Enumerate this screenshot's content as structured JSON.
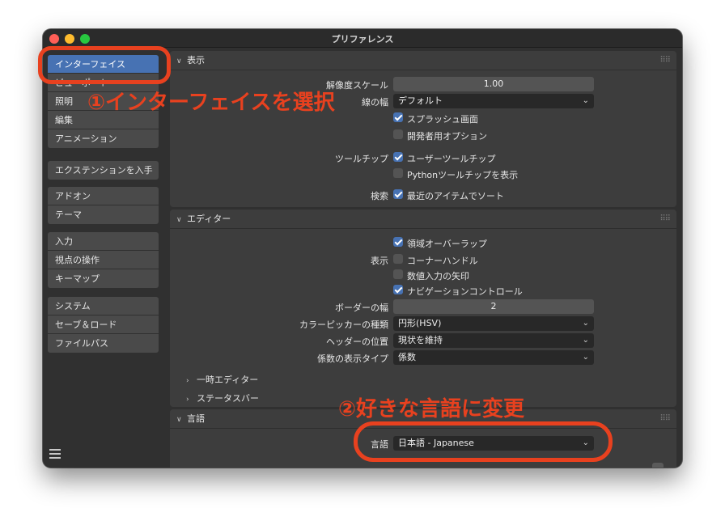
{
  "window": {
    "title": "プリファレンス"
  },
  "sidebar": {
    "groups": [
      [
        "インターフェイス",
        "ビューポート",
        "照明",
        "編集",
        "アニメーション"
      ],
      [
        "エクステンションを入手"
      ],
      [
        "アドオン",
        "テーマ"
      ],
      [
        "入力",
        "視点の操作",
        "キーマップ"
      ],
      [
        "システム",
        "セーブ＆ロード",
        "ファイルパス"
      ]
    ],
    "active": "インターフェイス",
    "menu_icon": "hamburger-icon"
  },
  "display_panel": {
    "title": "表示",
    "resolution_scale_label": "解像度スケール",
    "resolution_scale_value": "1.00",
    "line_width_label": "線の幅",
    "line_width_value": "デフォルト",
    "splash_label": "スプラッシュ画面",
    "splash_checked": true,
    "dev_options_label": "開発者用オプション",
    "dev_options_checked": false,
    "tooltips_label": "ツールチップ",
    "user_tooltips_label": "ユーザーツールチップ",
    "user_tooltips_checked": true,
    "python_tooltips_label": "Pythonツールチップを表示",
    "python_tooltips_checked": false,
    "search_label": "検索",
    "sort_recent_label": "最近のアイテムでソート",
    "sort_recent_checked": true
  },
  "editors_panel": {
    "title": "エディター",
    "display_label": "表示",
    "region_overlap_label": "領域オーバーラップ",
    "region_overlap_checked": true,
    "corner_handles_label": "コーナーハンドル",
    "corner_handles_checked": false,
    "numeric_arrows_label": "数値入力の矢印",
    "numeric_arrows_checked": false,
    "nav_controls_label": "ナビゲーションコントロール",
    "nav_controls_checked": true,
    "border_width_label": "ボーダーの幅",
    "border_width_value": "2",
    "color_picker_label": "カラーピッカーの種類",
    "color_picker_value": "円形(HSV)",
    "header_position_label": "ヘッダーの位置",
    "header_position_value": "現状を維持",
    "factor_display_label": "係数の表示タイプ",
    "factor_display_value": "係数",
    "temp_editors_label": "一時エディター",
    "status_bar_label": "ステータスバー"
  },
  "language_panel": {
    "title": "言語",
    "language_label": "言語",
    "language_value": "日本語 - Japanese"
  },
  "annotations": {
    "step1": "①インターフェイスを選択",
    "step2": "②好きな言語に変更",
    "color": "#e8411f"
  }
}
